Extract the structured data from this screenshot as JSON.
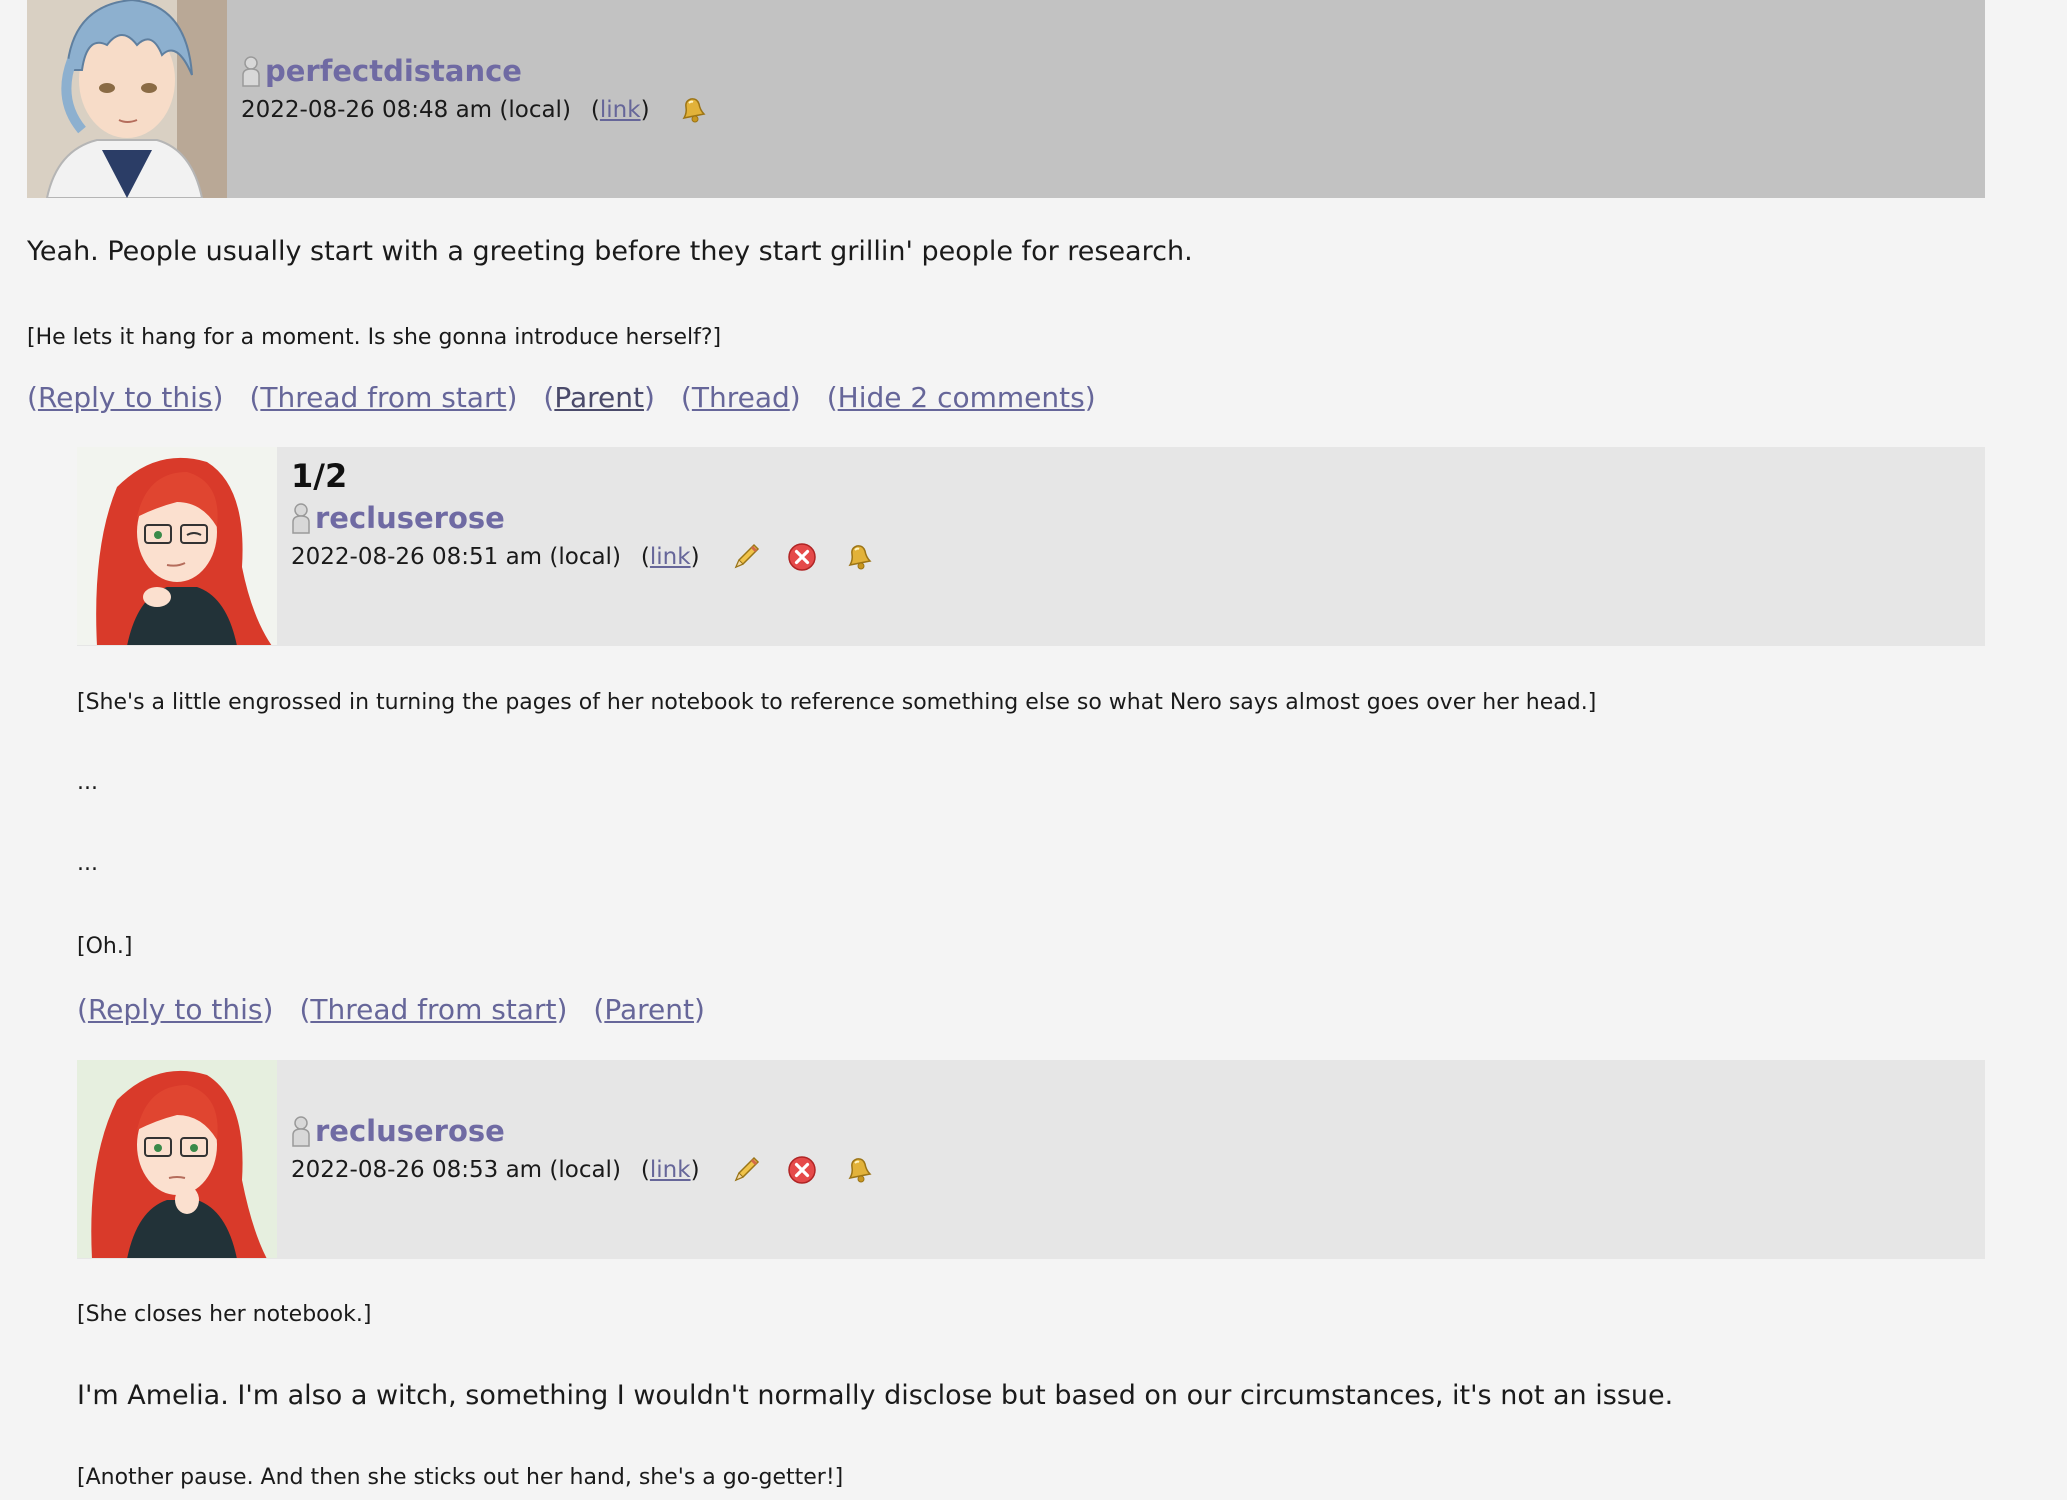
{
  "comments": [
    {
      "username": "perfectdistance",
      "date": "2022-08-26 08:48 am (local)",
      "link_label": "link",
      "paragraphs": [
        "Yeah. People usually start with a greeting before they start grillin' people for research.",
        "[He lets it hang for a moment. Is she gonna introduce herself?]"
      ],
      "actions": [
        "Reply to this",
        "Thread from start",
        "Parent",
        "Thread",
        "Hide 2 comments"
      ],
      "icons": [
        "bell-icon"
      ]
    },
    {
      "subject": "1/2",
      "username": "recluserose",
      "date": "2022-08-26 08:51 am (local)",
      "link_label": "link",
      "paragraphs": [
        "[She's a little engrossed in turning the pages of her notebook to reference something else so what Nero says almost goes over her head.]",
        "...",
        "...",
        "[Oh.]"
      ],
      "actions": [
        "Reply to this",
        "Thread from start",
        "Parent"
      ],
      "icons": [
        "pencil-icon",
        "delete-icon",
        "bell-icon"
      ]
    },
    {
      "username": "recluserose",
      "date": "2022-08-26 08:53 am (local)",
      "link_label": "link",
      "paragraphs": [
        "[She closes her notebook.]",
        "I'm Amelia. I'm also a witch, something I wouldn't normally disclose but based on our circumstances, it's not an issue.",
        "[Another pause. And then she sticks out her hand, she's a go-getter!]"
      ],
      "icons": [
        "pencil-icon",
        "delete-icon",
        "bell-icon"
      ]
    }
  ],
  "colors": {
    "page_bg": "#f4f4f4",
    "top_header_bg": "#c2c2c2",
    "nested_header_bg": "#e6e6e6",
    "username": "#6f6aa3",
    "link": "#666699"
  }
}
